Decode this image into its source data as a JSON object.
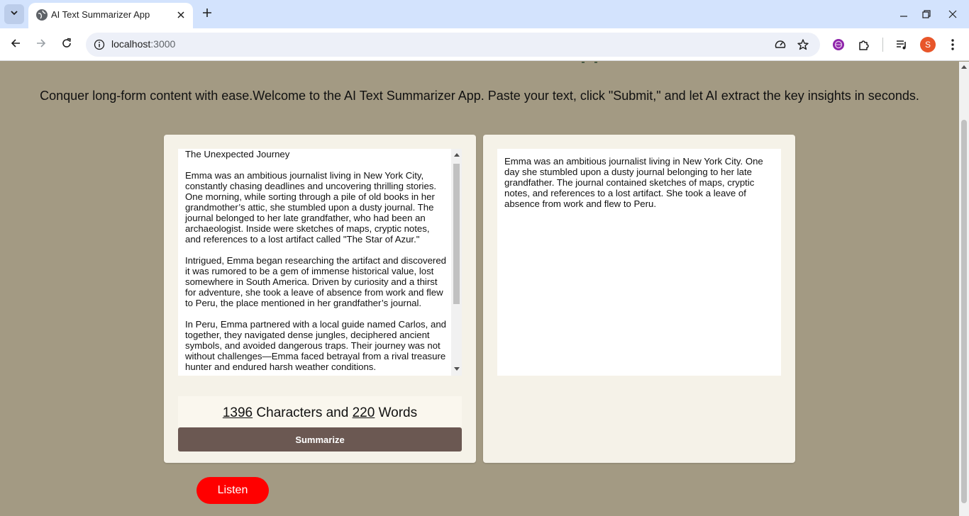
{
  "browser": {
    "tab_title": "AI Text Summarizer App",
    "url_host": "localhost",
    "url_port": ":3000",
    "avatar_letter": "S"
  },
  "page": {
    "intro": "Conquer long-form content with ease.Welcome to the AI Text Summarizer App. Paste your text, click \"Submit,\" and let AI extract the key insights in seconds.",
    "input_paragraphs": [
      "The Unexpected Journey",
      "Emma was an ambitious journalist living in New York City, constantly chasing deadlines and uncovering thrilling stories. One morning, while sorting through a pile of old books in her grandmother’s attic, she stumbled upon a dusty journal. The journal belonged to her late grandfather, who had been an archaeologist. Inside were sketches of maps, cryptic notes, and references to a lost artifact called \"The Star of Azur.\"",
      "Intrigued, Emma began researching the artifact and discovered it was rumored to be a gem of immense historical value, lost somewhere in South America. Driven by curiosity and a thirst for adventure, she took a leave of absence from work and flew to Peru, the place mentioned in her grandfather’s journal.",
      "In Peru, Emma partnered with a local guide named Carlos, and together, they navigated dense jungles, deciphered ancient symbols, and avoided dangerous traps. Their journey was not without challenges—Emma faced betrayal from a rival treasure hunter and endured harsh weather conditions."
    ],
    "char_count": "1396",
    "chars_label": " Characters and ",
    "word_count": "220",
    "words_label": " Words",
    "summarize_label": "Summarize",
    "summary": "Emma was an ambitious journalist living in New York City. One day she stumbled upon a dusty journal belonging to her late grandfather. The journal contained sketches of maps, cryptic notes, and references to a lost artifact. She took a leave of absence from work and flew to Peru.",
    "listen_label": "Listen"
  },
  "icons": {
    "tab_menu": "chevron-down-icon",
    "favicon": "globe-icon",
    "tab_close": "close-icon",
    "new_tab": "plus-icon",
    "back": "arrow-left-icon",
    "forward": "arrow-right-icon",
    "reload": "reload-icon",
    "site_info": "info-icon",
    "performance": "gauge-icon",
    "bookmark": "star-icon",
    "extension_purple": "extension-icon",
    "extensions": "puzzle-icon",
    "media": "media-queue-icon",
    "menu": "kebab-menu-icon"
  },
  "colors": {
    "page_bg": "#a39a83",
    "card_bg": "#f5f2e8",
    "summarize_bg": "#6b5852",
    "listen_bg": "#ff0000",
    "tabbar_bg": "#d3e3fd"
  }
}
